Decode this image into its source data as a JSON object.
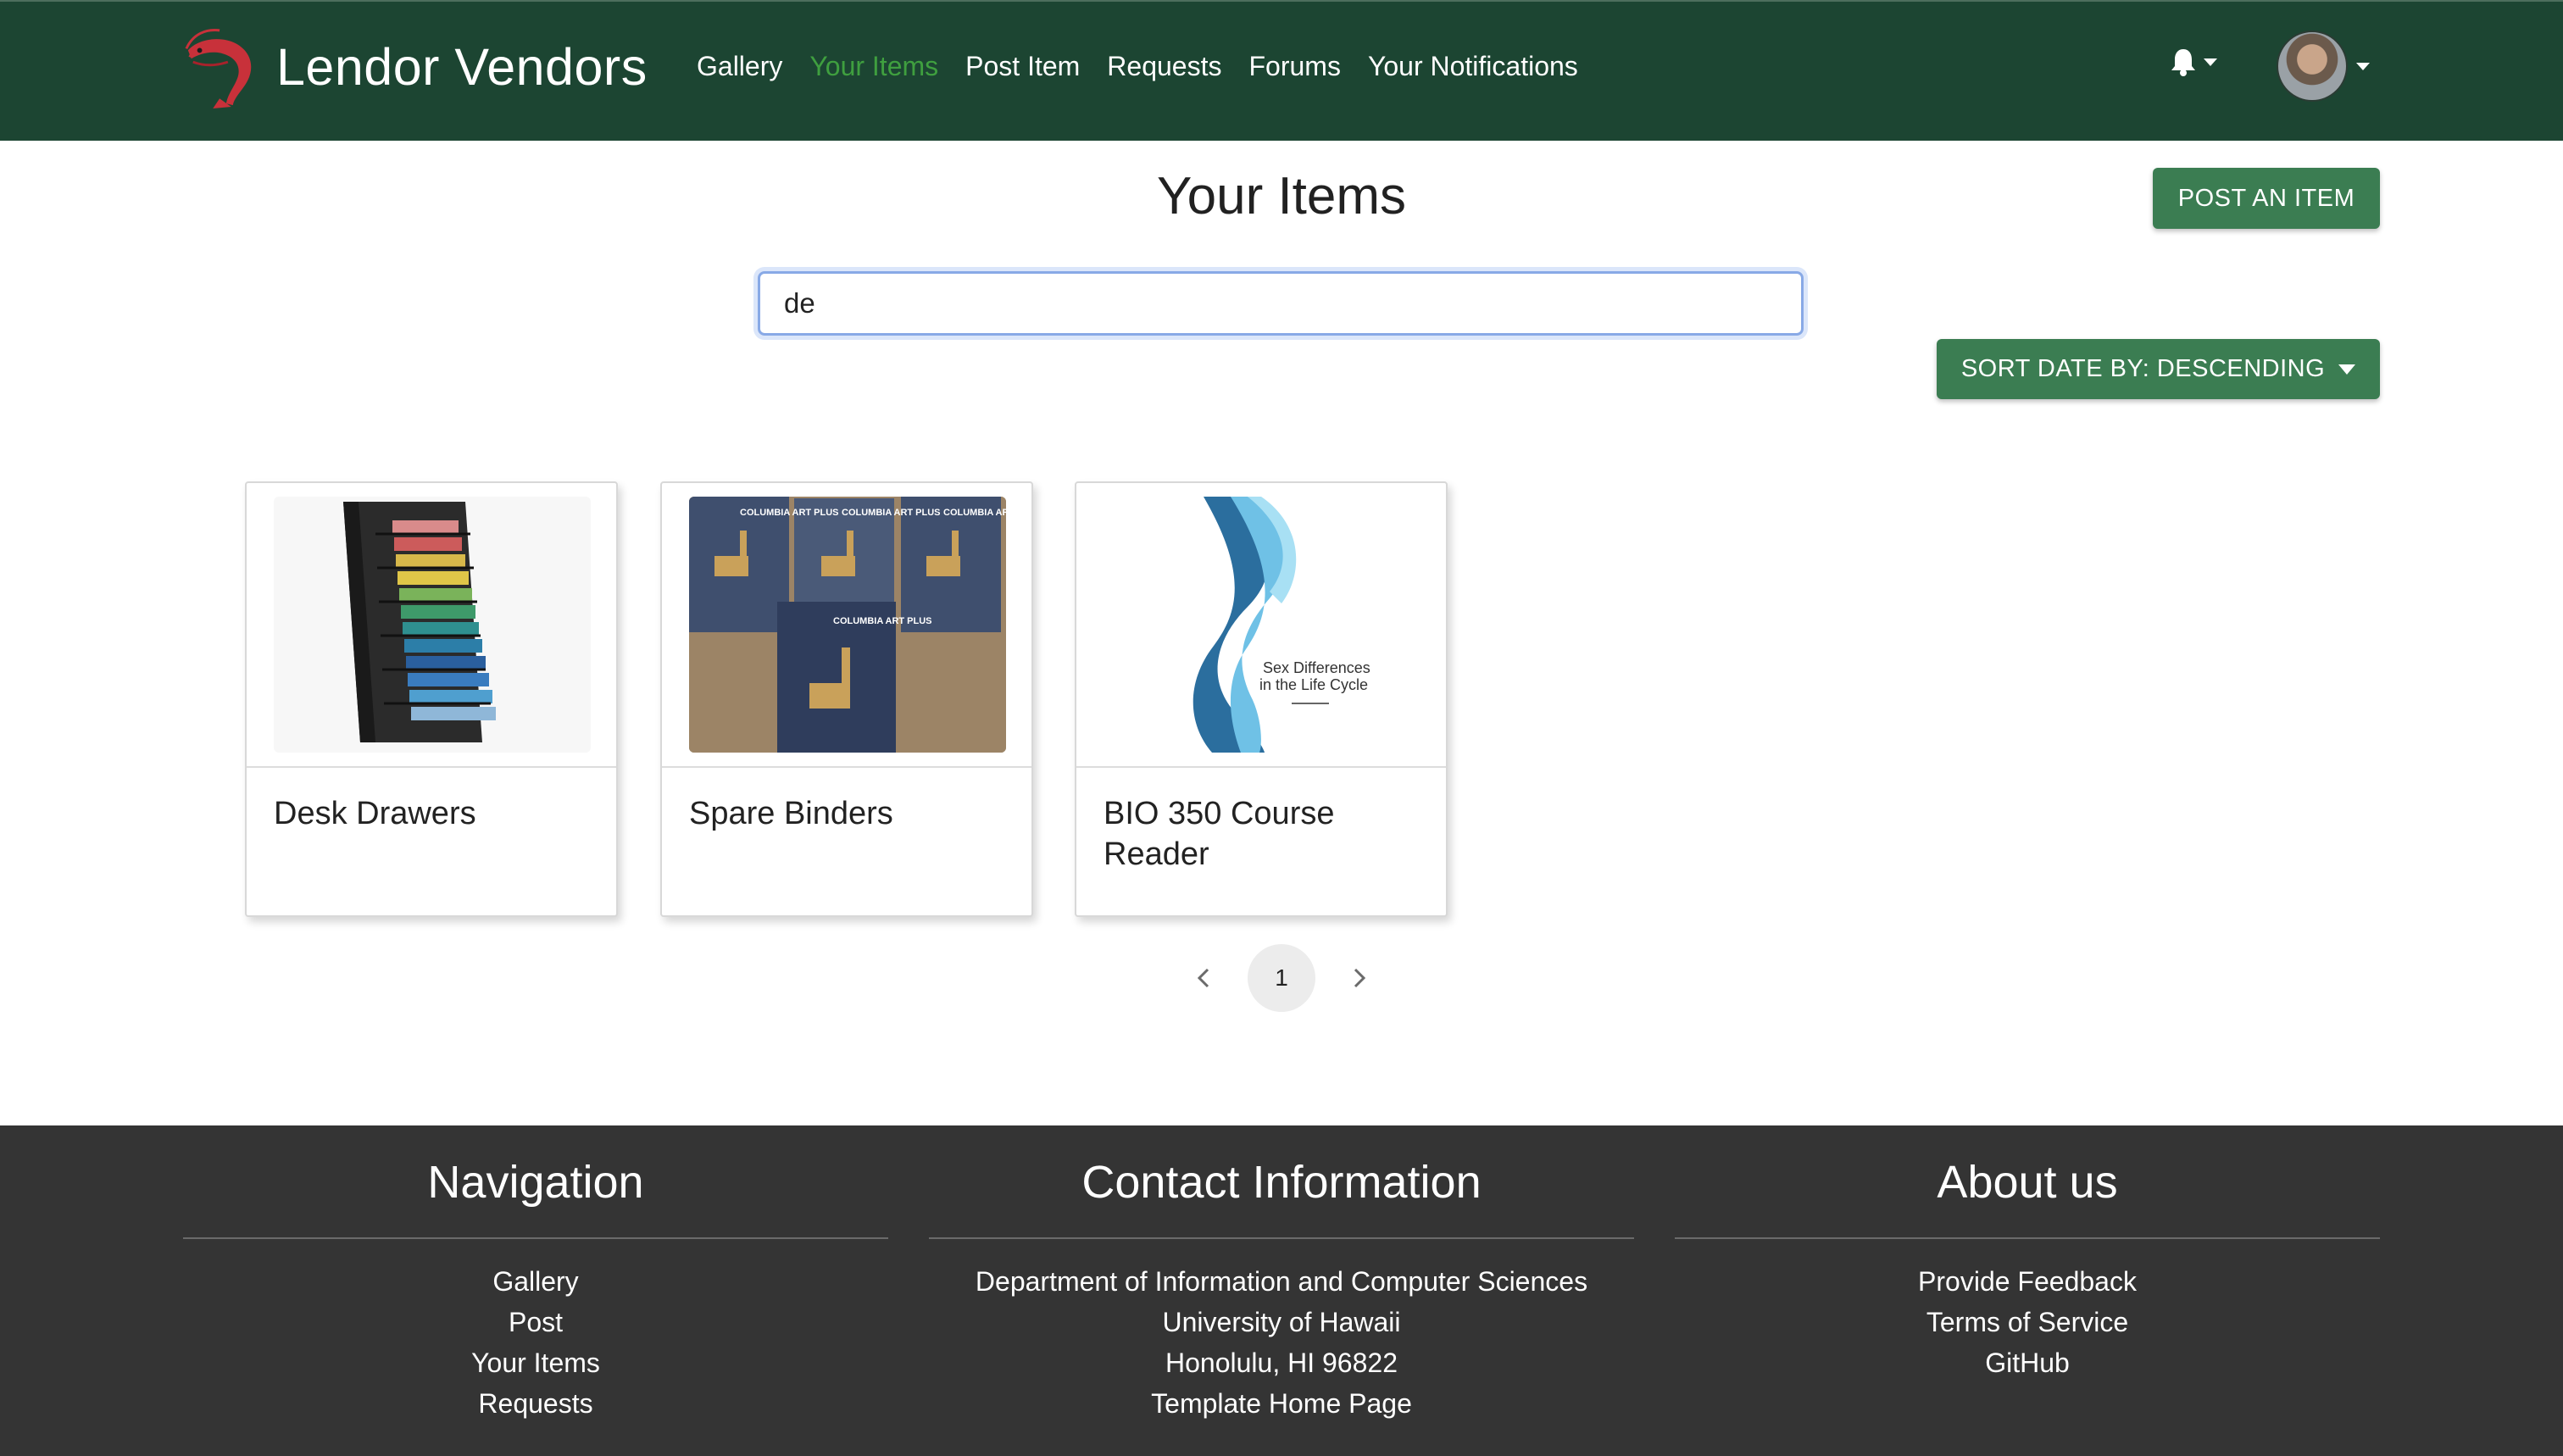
{
  "navbar": {
    "brand": "Lendor Vendors",
    "links": [
      "Gallery",
      "Your Items",
      "Post Item",
      "Requests",
      "Forums",
      "Your Notifications"
    ],
    "active_link": "Your Items"
  },
  "main": {
    "title": "Your Items",
    "post_button": "POST AN ITEM",
    "search": {
      "value": "de"
    },
    "sort_button": "SORT DATE BY: DESCENDING",
    "cards": [
      {
        "title": "Desk Drawers"
      },
      {
        "title": "Spare Binders",
        "image_text": "COLUMBIA ART PLUS"
      },
      {
        "title": "BIO 350 Course Reader",
        "image_text": [
          "Sex Differences",
          "in the Life Cycle"
        ]
      }
    ],
    "pagination": {
      "current_page": "1"
    }
  },
  "footer": {
    "navigation": {
      "heading": "Navigation",
      "links": [
        "Gallery",
        "Post",
        "Your Items",
        "Requests"
      ]
    },
    "contact": {
      "heading": "Contact Information",
      "lines": [
        "Department of Information and Computer Sciences",
        "University of Hawaii",
        "Honolulu, HI 96822",
        "Template Home Page"
      ]
    },
    "about": {
      "heading": "About us",
      "links": [
        "Provide Feedback",
        "Terms of Service",
        "GitHub"
      ]
    }
  },
  "colors": {
    "navbar_bg": "#1c4532",
    "active_link": "#3f9f3f",
    "button_green": "#3b7d52",
    "footer_bg": "#343434"
  }
}
